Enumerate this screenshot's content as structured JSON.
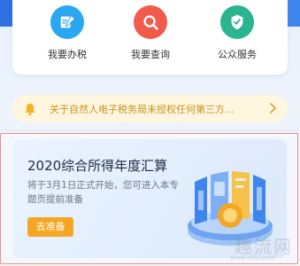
{
  "services": [
    {
      "label": "我要办税",
      "icon": "pen-icon",
      "color": "#29a7f0"
    },
    {
      "label": "我要查询",
      "icon": "search-icon",
      "color": "#f25a4b"
    },
    {
      "label": "公众服务",
      "icon": "tax-shield-icon",
      "color": "#2cb38f"
    }
  ],
  "notice": {
    "text": "关于自然人电子税务局未授权任何第三方..."
  },
  "promo": {
    "title": "2020综合所得年度汇算",
    "description": "将于3月1日正式开始，您可进入本专题页提前准备",
    "button_label": "去准备"
  },
  "watermark": {
    "text": "趣流网",
    "url": "www.qlliu.com"
  },
  "colors": {
    "accent": "#3f86ec",
    "notice_bg": "#fff6df",
    "notice_text": "#c7921c",
    "button": "#f5a623"
  }
}
